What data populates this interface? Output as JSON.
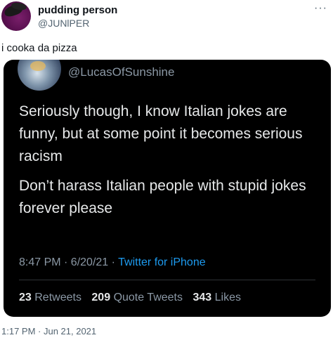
{
  "tweet": {
    "display_name": "pudding person",
    "handle": "@JUNlPER",
    "more_icon": "···",
    "text": "i cooka da pizza",
    "timestamp": "1:17 PM · Jun 21, 2021"
  },
  "embedded_tweet": {
    "handle": "@LucasOfSunshine",
    "paragraphs": [
      "Seriously though, I know Italian jokes are funny, but at some point it becomes serious racism",
      "Don’t harass Italian people with stupid jokes forever please"
    ],
    "time": "8:47 PM · 6/20/21 · ",
    "source": "Twitter for iPhone",
    "stats": {
      "retweets_count": "23",
      "retweets_label": "Retweets",
      "quotes_count": "209",
      "quotes_label": "Quote Tweets",
      "likes_count": "343",
      "likes_label": "Likes"
    }
  },
  "colors": {
    "accent": "#1d9bf0",
    "embed_bg": "#000000",
    "embed_text": "#e7e9ea",
    "muted": "#8b98a5"
  }
}
